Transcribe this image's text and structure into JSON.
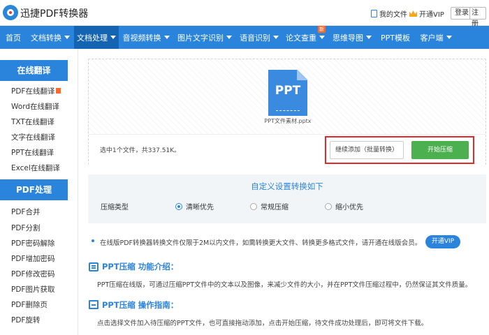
{
  "header": {
    "brand": "迅捷PDF转换器",
    "my_files": "我的文件",
    "open_vip": "开通VIP",
    "login": "登录",
    "register": "注册"
  },
  "nav": {
    "items": [
      {
        "label": "首页"
      },
      {
        "label": "文档转换"
      },
      {
        "label": "文档处理"
      },
      {
        "label": "音视频转换"
      },
      {
        "label": "图片文字识别"
      },
      {
        "label": "语音识别"
      },
      {
        "label": "论文查重"
      },
      {
        "label": "思维导图"
      },
      {
        "label": "PPT模板"
      },
      {
        "label": "客户端"
      }
    ],
    "new_badge": "新"
  },
  "sidebar": {
    "translate_head": "在线翻译",
    "translate_items": [
      "PDF在线翻译",
      "Word在线翻译",
      "TXT在线翻译",
      "文字在线翻译",
      "PPT在线翻译",
      "Excel在线翻译"
    ],
    "pdf_head": "PDF处理",
    "pdf_items": [
      "PDF合并",
      "PDF分割",
      "PDF密码解除",
      "PDF增加密码",
      "PDF修改密码",
      "PDF图片获取",
      "PDF删除页",
      "PDF旋转"
    ]
  },
  "upload": {
    "icon_text": "PPT",
    "file_name": "PPT文件素材.pptx",
    "count_text": "选中1个文件，共337.51K。",
    "add_button": "继续添加（批量转换）",
    "start_button": "开始压缩"
  },
  "settings": {
    "title": "自定义设置转换如下",
    "label": "压缩类型",
    "options": [
      {
        "label": "清晰优先",
        "selected": true
      },
      {
        "label": "常规压缩",
        "selected": false
      },
      {
        "label": "缩小优先",
        "selected": false
      }
    ]
  },
  "notice": {
    "text": "在线版PDF转换器转换文件仅限于2M以内文件，如需转换更大文件、转换更多格式文件，请开通在线版会员。",
    "vip_button": "开通VIP"
  },
  "intro": {
    "title": "PPT压缩 功能介绍：",
    "text": "PPT压缩在线版，可通过压缩PPT文件中的文本以及图像，来减少文件的大小，并在PPT文件压缩过程中，仍然保证其文件质量。"
  },
  "guide": {
    "title": "PPT压缩 操作指南：",
    "text": "点击选择文件加入待压缩的PPT文件，也可直接拖动添加，点击开始压缩，待文件成功处理后，即可将文件下载。"
  },
  "colors": {
    "accent": "#2b84dc",
    "nav_active": "#1464b4",
    "start_green": "#4caf50",
    "highlight_red": "#e02b2b"
  }
}
